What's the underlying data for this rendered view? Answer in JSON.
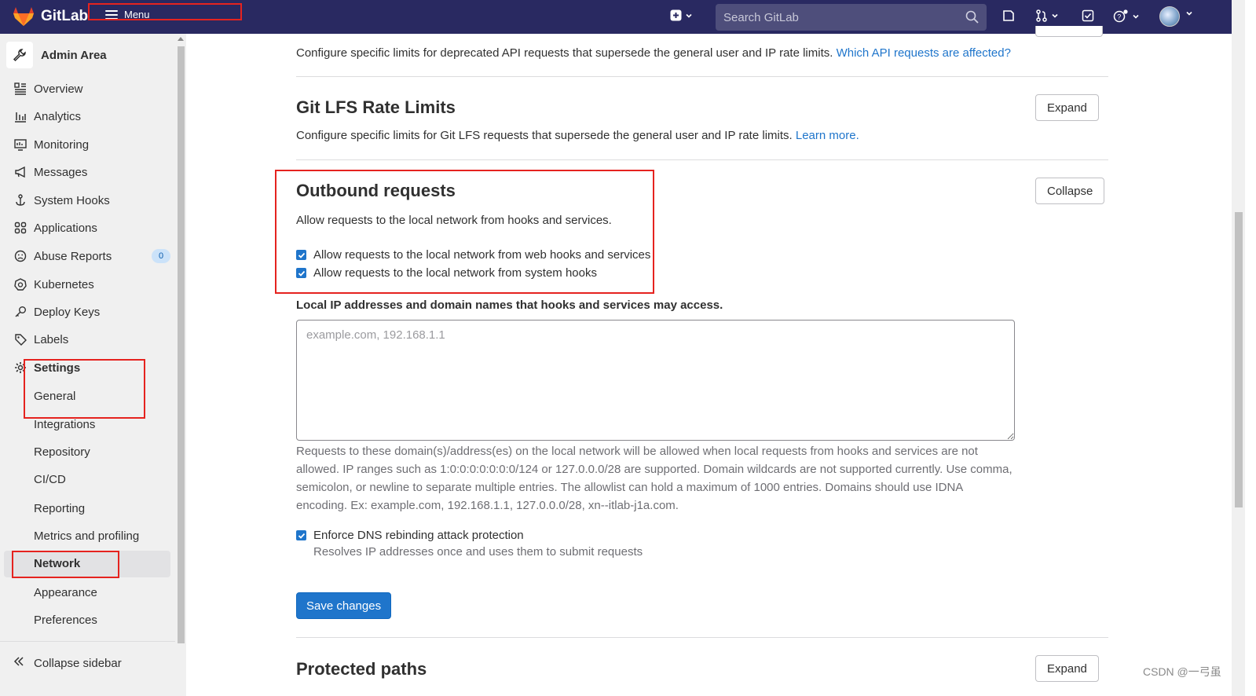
{
  "navbar": {
    "brand": "GitLab",
    "menu_label": "Menu",
    "search_placeholder": "Search GitLab"
  },
  "sidebar": {
    "title": "Admin Area",
    "items": [
      {
        "label": "Overview",
        "icon": "overview-icon"
      },
      {
        "label": "Analytics",
        "icon": "analytics-icon"
      },
      {
        "label": "Monitoring",
        "icon": "monitoring-icon"
      },
      {
        "label": "Messages",
        "icon": "messages-icon"
      },
      {
        "label": "System Hooks",
        "icon": "hook-icon"
      },
      {
        "label": "Applications",
        "icon": "applications-icon"
      },
      {
        "label": "Abuse Reports",
        "icon": "abuse-icon",
        "badge": "0"
      },
      {
        "label": "Kubernetes",
        "icon": "kubernetes-icon"
      },
      {
        "label": "Deploy Keys",
        "icon": "key-icon"
      },
      {
        "label": "Labels",
        "icon": "label-icon"
      },
      {
        "label": "Settings",
        "icon": "gear-icon"
      }
    ],
    "settings_sub": [
      "General",
      "Integrations",
      "Repository",
      "CI/CD",
      "Reporting",
      "Metrics and profiling",
      "Network",
      "Appearance",
      "Preferences"
    ],
    "active_sub": "Network",
    "collapse_label": "Collapse sidebar"
  },
  "main": {
    "deprecated_api": {
      "desc": "Configure specific limits for deprecated API requests that supersede the general user and IP rate limits.",
      "link": "Which API requests are affected?"
    },
    "git_lfs": {
      "title": "Git LFS Rate Limits",
      "desc": "Configure specific limits for Git LFS requests that supersede the general user and IP rate limits.",
      "link": "Learn more.",
      "button": "Expand"
    },
    "outbound": {
      "title": "Outbound requests",
      "desc": "Allow requests to the local network from hooks and services.",
      "button": "Collapse",
      "check1": "Allow requests to the local network from web hooks and services",
      "check2": "Allow requests to the local network from system hooks",
      "allowlist_label": "Local IP addresses and domain names that hooks and services may access.",
      "allowlist_placeholder": "example.com, 192.168.1.1",
      "help": "Requests to these domain(s)/address(es) on the local network will be allowed when local requests from hooks and services are not allowed. IP ranges such as 1:0:0:0:0:0:0:0/124 or 127.0.0.0/28 are supported. Domain wildcards are not supported currently. Use comma, semicolon, or newline to separate multiple entries. The allowlist can hold a maximum of 1000 entries. Domains should use IDNA encoding. Ex: example.com, 192.168.1.1, 127.0.0.0/28, xn--itlab-j1a.com.",
      "dns_check": "Enforce DNS rebinding attack protection",
      "dns_help": "Resolves IP addresses once and uses them to submit requests",
      "save": "Save changes"
    },
    "protected_paths": {
      "title": "Protected paths",
      "button": "Expand"
    }
  },
  "watermark": "CSDN @一弓虽",
  "colors": {
    "navbar": "#292961",
    "accent": "#1f75cb",
    "highlight": "#e5231f"
  }
}
